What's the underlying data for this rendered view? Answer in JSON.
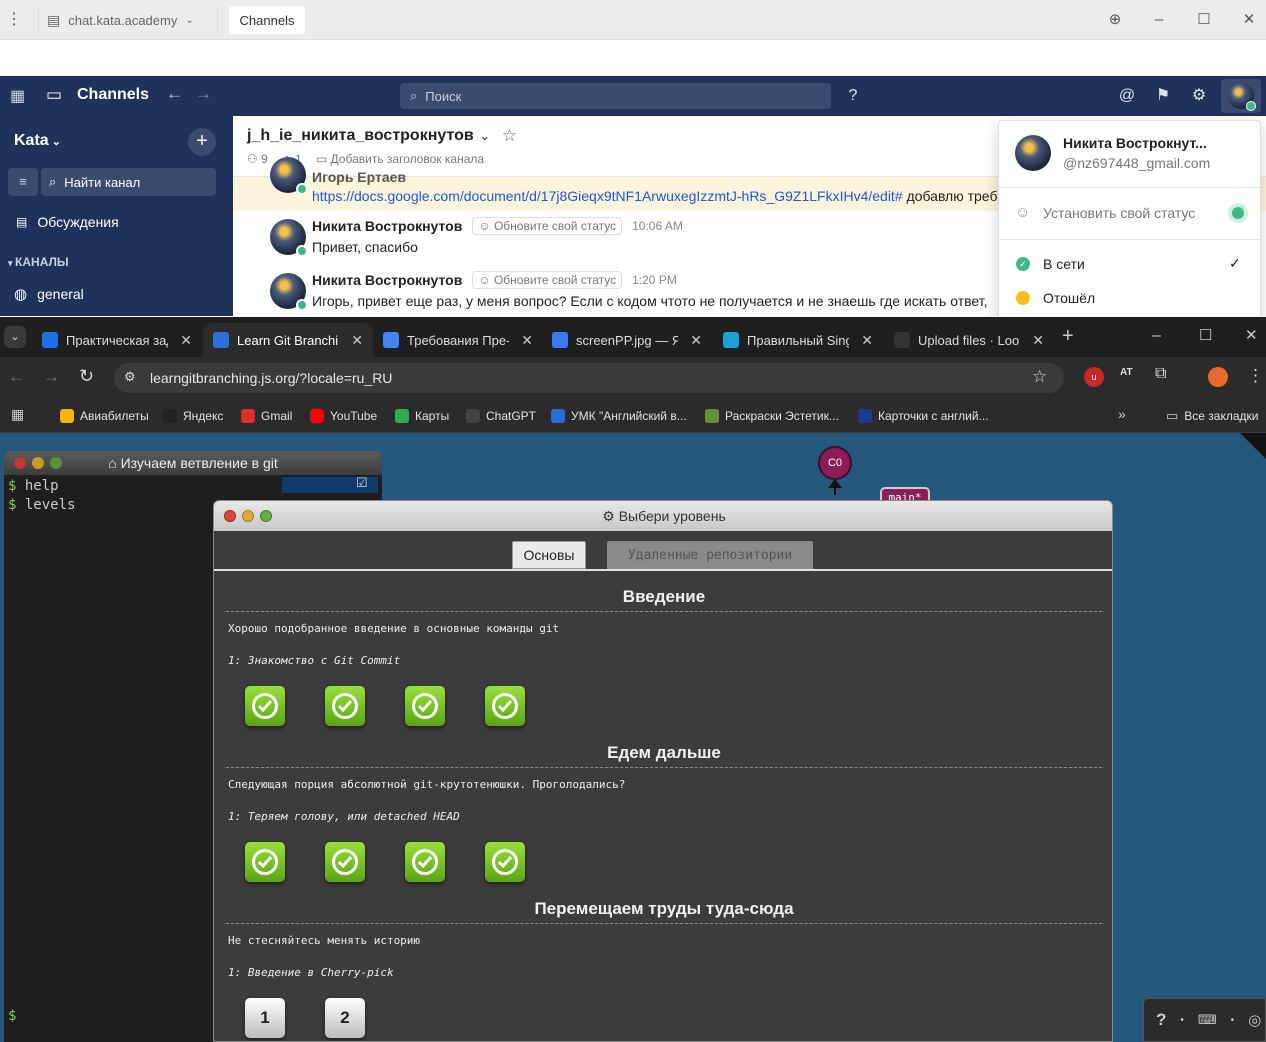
{
  "mm_titlebar": {
    "server": "chat.kata.academy",
    "tab": "Channels"
  },
  "mm_header": {
    "product": "Channels",
    "search_placeholder": "Поиск"
  },
  "mm_sidebar": {
    "team": "Kata",
    "find_channel": "Найти канал",
    "threads": "Обсуждения",
    "channels_heading": "КАНАЛЫ",
    "channel_general": "general"
  },
  "mm_channel": {
    "name": "j_h_ie_никита_вострокнутов",
    "members": "9",
    "pinned": "1",
    "add_header": "Добавить заголовок канала"
  },
  "mm_messages": [
    {
      "name": "Игорь Ертаев",
      "link": "https://docs.google.com/document/d/17j8Gieqx9tNF1ArwuxegIzzmtJ-hRs_G9Z1LFkxIHv4/edit#",
      "text": "добавлю треб"
    },
    {
      "name": "Никита Вострокнутов",
      "status": "Обновите свой статус",
      "time": "10:06 AM",
      "text": "Привет, спасибо"
    },
    {
      "name": "Никита Вострокнутов",
      "status": "Обновите свой статус",
      "time": "1:20 PM",
      "text": "Игорь, привет еще раз, у меня вопрос? Если с кодом чтото не получается и не знаешь где искать ответ,"
    }
  ],
  "mm_dropdown": {
    "user_name": "Никита Вострокнут...",
    "user_handle": "@nz697448_gmail.com",
    "set_status": "Установить свой статус",
    "online": "В сети",
    "away": "Отошёл",
    "online_color": "#3db887",
    "away_color": "#ffbc1f"
  },
  "chrome_tabs": [
    {
      "label": "Практическая зад",
      "icon": "kata-icon",
      "color": "#1f6feb"
    },
    {
      "label": "Learn Git Branching",
      "icon": "git-branching-icon",
      "color": "#2f6fd6"
    },
    {
      "label": "Требования Пре-I",
      "icon": "google-docs-icon",
      "color": "#4285f4"
    },
    {
      "label": "screenPP.jpg — Ян",
      "icon": "yandex-disk-icon",
      "color": "#3b7bf5"
    },
    {
      "label": "Правильный Singl",
      "icon": "puzzle-icon",
      "color": "#1aa1d6"
    },
    {
      "label": "Upload files · Loop",
      "icon": "github-icon",
      "color": "#333333"
    }
  ],
  "chrome_url": "learngitbranching.js.org/?locale=ru_RU",
  "bookmarks": [
    {
      "label": "Авиабилеты",
      "icon": "plane-icon",
      "color": "#f5b400"
    },
    {
      "label": "Яндекс",
      "icon": "yandex-icon",
      "color": "#222222"
    },
    {
      "label": "Gmail",
      "icon": "gmail-icon",
      "color": "#d93025"
    },
    {
      "label": "YouTube",
      "icon": "youtube-icon",
      "color": "#ff0000"
    },
    {
      "label": "Карты",
      "icon": "maps-icon",
      "color": "#34a853"
    },
    {
      "label": "ChatGPT",
      "icon": "chatgpt-icon",
      "color": "#444444"
    },
    {
      "label": "УМК \"Английский в...",
      "icon": "book-icon",
      "color": "#2b6cd8"
    },
    {
      "label": "Раскраски Эстетик...",
      "icon": "palette-icon",
      "color": "#6a8f3a"
    },
    {
      "label": "Карточки с англий...",
      "icon": "en-icon",
      "color": "#1e3a8a"
    }
  ],
  "all_bookmarks": "Все закладки",
  "terminal": {
    "title": "Изучаем ветвление в git",
    "lines": [
      "help",
      "levels"
    ],
    "prompt": "$"
  },
  "graph": {
    "commit": "C0",
    "branch": "main*"
  },
  "levels_dialog": {
    "title": "Выбери уровень",
    "tab_main": "Основы",
    "tab_remote": "Удаленные репозитории",
    "sections": [
      {
        "title": "Введение",
        "desc": "Хорошо подобранное введение в основные команды git",
        "sub": "1: Знакомство с Git Commit"
      },
      {
        "title": "Едем дальше",
        "desc": "Следующая порция абсолютной git-крутотенюшки. Проголодались?",
        "sub": "1: Теряем голову, или detached HEAD"
      },
      {
        "title": "Перемещаем труды туда-сюда",
        "desc": "Не стесняйтесь менять историю",
        "sub": "1: Введение в Cherry-pick"
      }
    ],
    "level_numbers": [
      "1",
      "2"
    ]
  },
  "help_bar": {
    "help": "?"
  }
}
